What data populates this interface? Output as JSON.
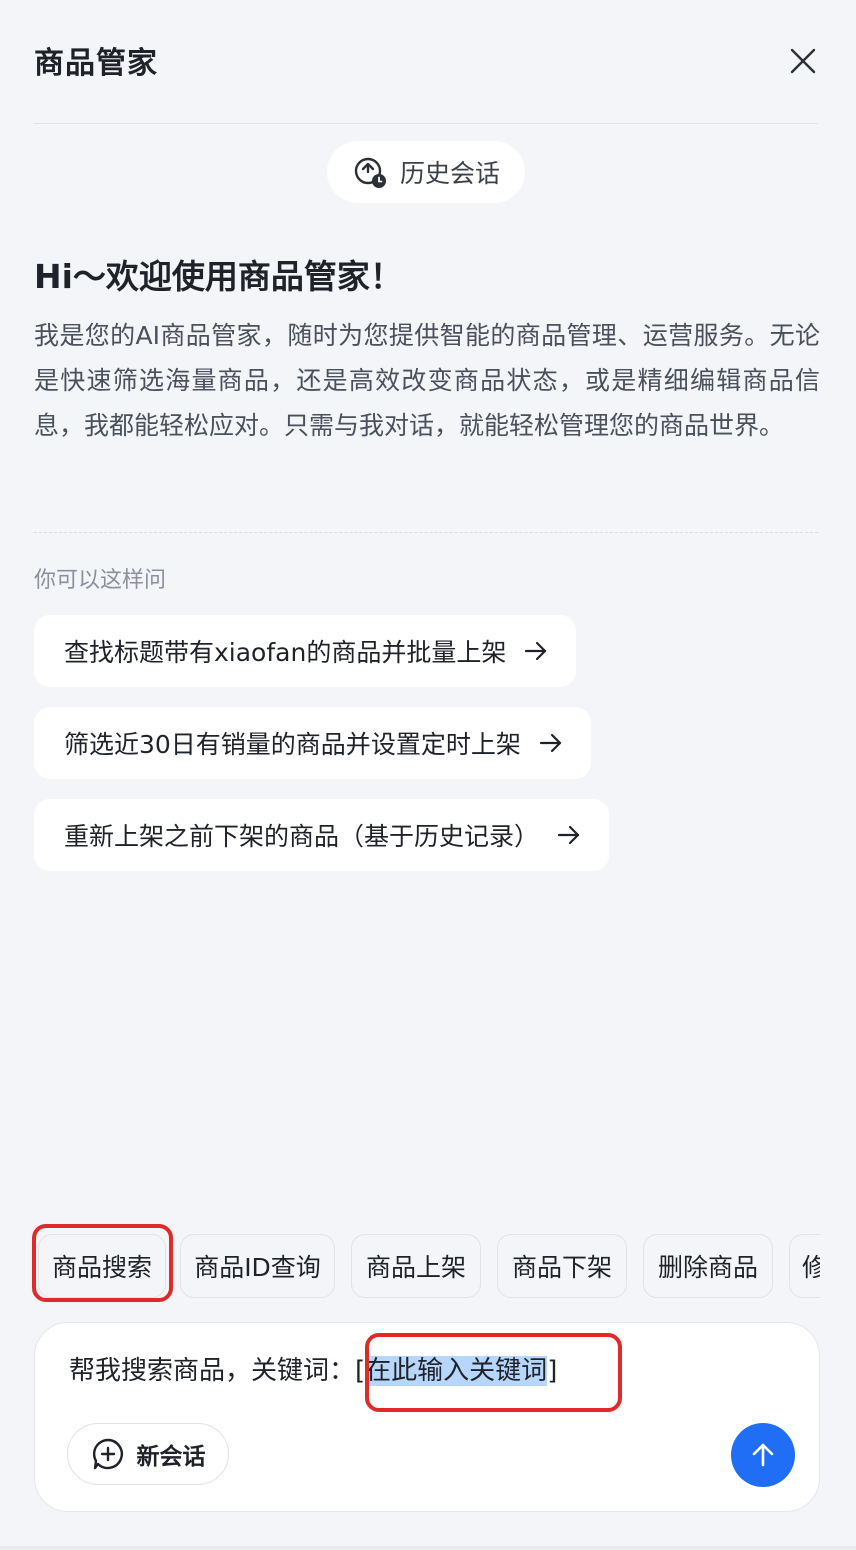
{
  "header": {
    "title": "商品管家",
    "close_icon": "close-icon"
  },
  "history": {
    "label": "历史会话",
    "icon": "history-icon"
  },
  "welcome": {
    "greeting": "Hi～欢迎使用商品管家！",
    "intro": "我是您的AI商品管家，随时为您提供智能的商品管理、运营服务。无论是快速筛选海量商品，还是高效改变商品状态，或是精细编辑商品信息，我都能轻松应对。只需与我对话，就能轻松管理您的商品世界。"
  },
  "suggestions": {
    "label": "你可以这样问",
    "items": [
      {
        "text": "查找标题带有xiaofan的商品并批量上架"
      },
      {
        "text": "筛选近30日有销量的商品并设置定时上架"
      },
      {
        "text": "重新上架之前下架的商品（基于历史记录）"
      }
    ]
  },
  "quick_actions": [
    {
      "label": "商品搜索",
      "selected": true
    },
    {
      "label": "商品ID查询"
    },
    {
      "label": "商品上架"
    },
    {
      "label": "商品下架"
    },
    {
      "label": "删除商品"
    },
    {
      "label": "修"
    }
  ],
  "composer": {
    "prefix": "帮我搜索商品，关键词：",
    "bracket_open": "[",
    "placeholder": "在此输入关键词",
    "bracket_close": "]",
    "new_chat_label": "新会话",
    "send_icon": "arrow-up-icon"
  },
  "colors": {
    "accent": "#1f6ef5",
    "highlight": "#e02a2a",
    "selection": "#b7d6fb",
    "background": "#f4f5f8"
  }
}
